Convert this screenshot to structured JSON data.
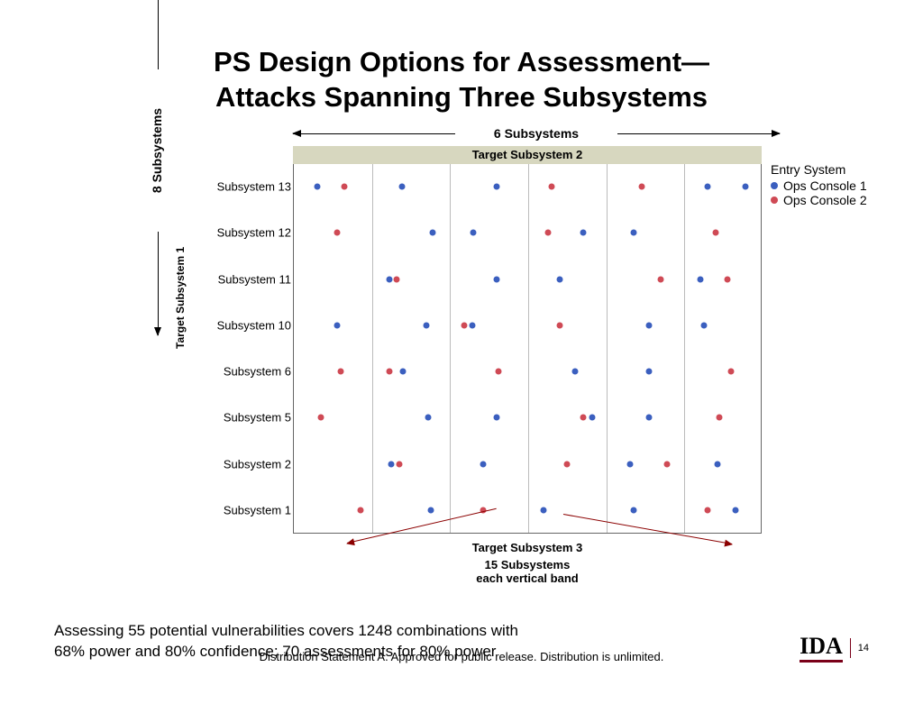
{
  "title_line1": "PS Design Options for Assessment—",
  "title_line2": "Attacks Spanning Three Subsystems",
  "top_axis_count": "6 Subsystems",
  "header_band": "Target Subsystem 2",
  "y_inner_axis": "Target Subsystem 1",
  "y_outer_axis": "8 Subsystems",
  "legend_title": "Entry System",
  "legend_items": [
    {
      "label": "Ops Console 1",
      "color": "#3b5fbf"
    },
    {
      "label": "Ops Console 2",
      "color": "#cf4a55"
    }
  ],
  "bottom_label1": "Target Subsystem 3",
  "bottom_label2": "15 Subsystems",
  "bottom_label3": "each vertical band",
  "summary_line1": "Assessing 55 potential vulnerabilities covers 1248 combinations with",
  "summary_line2": "68% power and 80% confidence; 70 assessments for 80% power",
  "distribution": "Distribution Statement A. Approved for public release. Distribution is unlimited.",
  "logo_text": "IDA",
  "page_number": "14",
  "chart_data": {
    "type": "scatter",
    "title": "PS Design Options for Assessment — Attacks Spanning Three Subsystems",
    "panel_variable": "Target Subsystem 2 (6 subsystems, columns 1-6)",
    "y_variable": "Target Subsystem 1 (8 subsystems, rows)",
    "y_categories": [
      "Subsystem 13",
      "Subsystem 12",
      "Subsystem 11",
      "Subsystem 10",
      "Subsystem 6",
      "Subsystem 5",
      "Subsystem 2",
      "Subsystem 1"
    ],
    "x_variable": "Target Subsystem 3 (15 subsystems per vertical band, jittered)",
    "series": [
      {
        "name": "Ops Console 1",
        "color": "#3b5fbf"
      },
      {
        "name": "Ops Console 2",
        "color": "#cf4a55"
      }
    ],
    "note": "Each row×column cell contains jittered points for one or both Entry System series. Values below are approximate x-jitter positions within each of the 6 panels (0–100) for each row.",
    "points": {
      "Subsystem 13": [
        {
          "panel": 1,
          "series": "Ops Console 1",
          "x": 30
        },
        {
          "panel": 1,
          "series": "Ops Console 2",
          "x": 65
        },
        {
          "panel": 2,
          "series": "Ops Console 1",
          "x": 38
        },
        {
          "panel": 3,
          "series": "Ops Console 1",
          "x": 60
        },
        {
          "panel": 4,
          "series": "Ops Console 2",
          "x": 30
        },
        {
          "panel": 5,
          "series": "Ops Console 2",
          "x": 45
        },
        {
          "panel": 6,
          "series": "Ops Console 1",
          "x": 30
        },
        {
          "panel": 6,
          "series": "Ops Console 1",
          "x": 78
        }
      ],
      "Subsystem 12": [
        {
          "panel": 1,
          "series": "Ops Console 2",
          "x": 55
        },
        {
          "panel": 2,
          "series": "Ops Console 1",
          "x": 78
        },
        {
          "panel": 3,
          "series": "Ops Console 1",
          "x": 30
        },
        {
          "panel": 4,
          "series": "Ops Console 2",
          "x": 25
        },
        {
          "panel": 4,
          "series": "Ops Console 1",
          "x": 70
        },
        {
          "panel": 5,
          "series": "Ops Console 1",
          "x": 35
        },
        {
          "panel": 6,
          "series": "Ops Console 2",
          "x": 40
        }
      ],
      "Subsystem 11": [
        {
          "panel": 2,
          "series": "Ops Console 1",
          "x": 22
        },
        {
          "panel": 2,
          "series": "Ops Console 2",
          "x": 32
        },
        {
          "panel": 3,
          "series": "Ops Console 1",
          "x": 60
        },
        {
          "panel": 4,
          "series": "Ops Console 1",
          "x": 40
        },
        {
          "panel": 5,
          "series": "Ops Console 2",
          "x": 70
        },
        {
          "panel": 6,
          "series": "Ops Console 1",
          "x": 20
        },
        {
          "panel": 6,
          "series": "Ops Console 2",
          "x": 55
        }
      ],
      "Subsystem 10": [
        {
          "panel": 1,
          "series": "Ops Console 1",
          "x": 55
        },
        {
          "panel": 2,
          "series": "Ops Console 1",
          "x": 70
        },
        {
          "panel": 3,
          "series": "Ops Console 2",
          "x": 18
        },
        {
          "panel": 3,
          "series": "Ops Console 1",
          "x": 28
        },
        {
          "panel": 4,
          "series": "Ops Console 2",
          "x": 40
        },
        {
          "panel": 5,
          "series": "Ops Console 1",
          "x": 55
        },
        {
          "panel": 6,
          "series": "Ops Console 1",
          "x": 25
        }
      ],
      "Subsystem 6": [
        {
          "panel": 1,
          "series": "Ops Console 2",
          "x": 60
        },
        {
          "panel": 2,
          "series": "Ops Console 2",
          "x": 22
        },
        {
          "panel": 2,
          "series": "Ops Console 1",
          "x": 40
        },
        {
          "panel": 3,
          "series": "Ops Console 2",
          "x": 62
        },
        {
          "panel": 4,
          "series": "Ops Console 1",
          "x": 60
        },
        {
          "panel": 5,
          "series": "Ops Console 1",
          "x": 55
        },
        {
          "panel": 6,
          "series": "Ops Console 2",
          "x": 60
        }
      ],
      "Subsystem 5": [
        {
          "panel": 1,
          "series": "Ops Console 2",
          "x": 35
        },
        {
          "panel": 2,
          "series": "Ops Console 1",
          "x": 72
        },
        {
          "panel": 3,
          "series": "Ops Console 1",
          "x": 60
        },
        {
          "panel": 4,
          "series": "Ops Console 2",
          "x": 70
        },
        {
          "panel": 4,
          "series": "Ops Console 1",
          "x": 82
        },
        {
          "panel": 5,
          "series": "Ops Console 1",
          "x": 55
        },
        {
          "panel": 6,
          "series": "Ops Console 2",
          "x": 45
        }
      ],
      "Subsystem 2": [
        {
          "panel": 2,
          "series": "Ops Console 1",
          "x": 25
        },
        {
          "panel": 2,
          "series": "Ops Console 2",
          "x": 35
        },
        {
          "panel": 3,
          "series": "Ops Console 1",
          "x": 42
        },
        {
          "panel": 4,
          "series": "Ops Console 2",
          "x": 50
        },
        {
          "panel": 5,
          "series": "Ops Console 1",
          "x": 30
        },
        {
          "panel": 5,
          "series": "Ops Console 2",
          "x": 78
        },
        {
          "panel": 6,
          "series": "Ops Console 1",
          "x": 42
        }
      ],
      "Subsystem 1": [
        {
          "panel": 1,
          "series": "Ops Console 2",
          "x": 85
        },
        {
          "panel": 2,
          "series": "Ops Console 1",
          "x": 75
        },
        {
          "panel": 3,
          "series": "Ops Console 2",
          "x": 42
        },
        {
          "panel": 4,
          "series": "Ops Console 1",
          "x": 20
        },
        {
          "panel": 5,
          "series": "Ops Console 1",
          "x": 35
        },
        {
          "panel": 6,
          "series": "Ops Console 2",
          "x": 30
        },
        {
          "panel": 6,
          "series": "Ops Console 1",
          "x": 65
        }
      ]
    }
  }
}
